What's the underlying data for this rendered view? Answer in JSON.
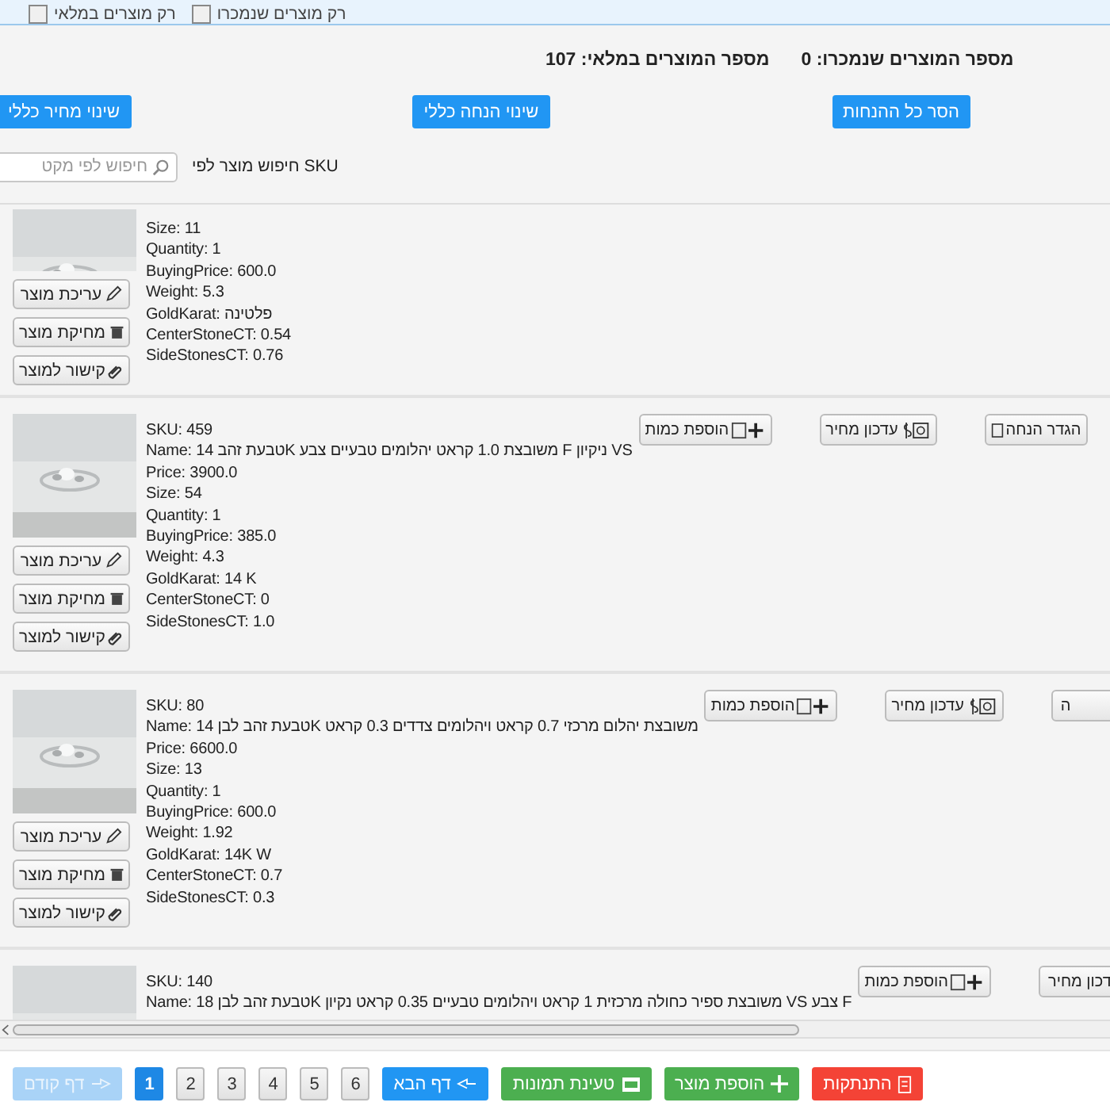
{
  "filters": [
    {
      "label": "רק מוצרים שנמכרו",
      "checked": false
    },
    {
      "label": "רק מוצרים במלאי",
      "checked": false
    }
  ],
  "stats": {
    "sold": "מספר המוצרים שנמכרו: 0",
    "in_stock": "מספר המוצרים במלאי: 107"
  },
  "bulk_buttons": [
    "הסר כל ההנחות",
    "שינוי הנחה כללי",
    "שינוי מחיר כללי"
  ],
  "search": {
    "label": "חיפוש מוצר לפי SKU",
    "placeholder": "חיפוש לפי מקט"
  },
  "products": [
    {
      "fields": [
        "Size: 11",
        "Quantity: 1",
        "BuyingPrice: 600.0",
        "Weight: 5.3",
        "GoldKarat: פלטינה",
        "CenterStoneCT: 0.54",
        "SideStonesCT: 0.76"
      ],
      "buttons": [
        "עריכת מוצר",
        "מחיקת מוצר",
        "קישור למוצר"
      ]
    },
    {
      "fields": [
        "SKU: 459",
        "Name: טבעת זהב 14K משובצת 1.0 קראט יהלומים טבעיים צבע F ניקיון VS",
        "Price: 3900.0",
        "Size: 54",
        "Quantity: 1",
        "BuyingPrice: 385.0",
        "Weight: 4.3",
        "GoldKarat: 14 K",
        "CenterStoneCT: 0",
        "SideStonesCT: 1.0"
      ],
      "buttons": [
        "עריכת מוצר",
        "מחיקת מוצר",
        "קישור למוצר"
      ],
      "actions": [
        {
          "kind": "set-discount",
          "label": "הגדר הנחה"
        },
        {
          "kind": "update-price",
          "label": "עדכון מחיר"
        },
        {
          "kind": "add-quantity",
          "label": "הוספת כמות"
        }
      ]
    },
    {
      "fields": [
        "SKU: 80",
        "Name: טבעת זהב לבן 14K משובצת יהלום מרכזי 0.7 קראט ויהלומים צדדים 0.3 קראט",
        "Price: 6600.0",
        "Size: 13",
        "Quantity: 1",
        "BuyingPrice: 600.0",
        "Weight: 1.92",
        "GoldKarat: 14K W",
        "CenterStoneCT: 0.7",
        "SideStonesCT: 0.3"
      ],
      "buttons": [
        "עריכת מוצר",
        "מחיקת מוצר",
        "קישור למוצר"
      ],
      "actions": [
        {
          "kind": "set-discount",
          "label": "ה",
          "cut": true
        },
        {
          "kind": "update-price",
          "label": "עדכון מחיר"
        },
        {
          "kind": "add-quantity",
          "label": "הוספת כמות"
        }
      ]
    },
    {
      "fields": [
        "SKU: 140",
        "Name: טבעת זהב לבן 18K משובצת ספיר כחולה מרכזית 1 קראט ויהלומים טבעיים 0.35 קראט נקיון VS צבע F"
      ],
      "actions": [
        {
          "kind": "update-price",
          "label": "דכון מחיר",
          "cut": true
        },
        {
          "kind": "add-quantity",
          "label": "הוספת כמות"
        }
      ]
    }
  ],
  "footer_buttons": [
    {
      "kind": "logout",
      "label": "התנתקות"
    },
    {
      "kind": "add-product",
      "label": "הוספת מוצר"
    },
    {
      "kind": "load-images",
      "label": "טעינת תמונות"
    }
  ],
  "pagination": {
    "next": {
      "label": "דף הבא",
      "disabled": false
    },
    "pages": [
      {
        "label": "6",
        "selected": false
      },
      {
        "label": "5",
        "selected": false
      },
      {
        "label": "4",
        "selected": false
      },
      {
        "label": "3",
        "selected": false
      },
      {
        "label": "2",
        "selected": false
      },
      {
        "label": "1",
        "selected": true
      }
    ],
    "previous": {
      "label": "דף קודם",
      "disabled": true
    }
  }
}
